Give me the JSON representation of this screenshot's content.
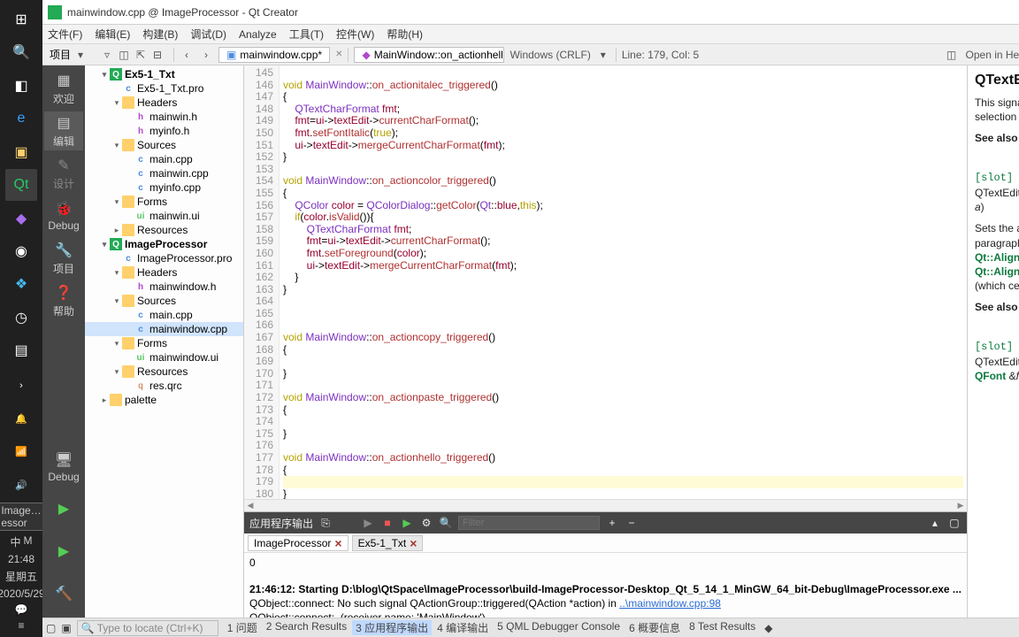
{
  "title": "mainwindow.cpp @ ImageProcessor - Qt Creator",
  "menubar": [
    "文件(F)",
    "编辑(E)",
    "构建(B)",
    "调试(D)",
    "Analyze",
    "工具(T)",
    "控件(W)",
    "帮助(H)"
  ],
  "pane_title": "项目",
  "toolbar": {
    "tab": "mainwindow.cpp*",
    "bread": "MainWindow::on_actionhello_t…",
    "encoding": "Windows (CRLF)",
    "pos": "Line: 179, Col: 5",
    "help_mode": "Open in Help Mode"
  },
  "rail": {
    "welcome": "欢迎",
    "edit": "编辑",
    "design": "设计",
    "debug": "Debug",
    "projects": "项目",
    "help": "帮助",
    "debug2": "Debug"
  },
  "tree": [
    {
      "lvl": 1,
      "caret": "▾",
      "ico": "proj",
      "label": "Ex5-1_Txt",
      "bold": true
    },
    {
      "lvl": 2,
      "caret": "",
      "ico": "cpp",
      "label": "Ex5-1_Txt.pro"
    },
    {
      "lvl": 2,
      "caret": "▾",
      "ico": "folder",
      "label": "Headers"
    },
    {
      "lvl": 3,
      "caret": "",
      "ico": "h",
      "label": "mainwin.h"
    },
    {
      "lvl": 3,
      "caret": "",
      "ico": "h",
      "label": "myinfo.h"
    },
    {
      "lvl": 2,
      "caret": "▾",
      "ico": "folder",
      "label": "Sources"
    },
    {
      "lvl": 3,
      "caret": "",
      "ico": "cpp",
      "label": "main.cpp"
    },
    {
      "lvl": 3,
      "caret": "",
      "ico": "cpp",
      "label": "mainwin.cpp"
    },
    {
      "lvl": 3,
      "caret": "",
      "ico": "cpp",
      "label": "myinfo.cpp"
    },
    {
      "lvl": 2,
      "caret": "▾",
      "ico": "folder",
      "label": "Forms"
    },
    {
      "lvl": 3,
      "caret": "",
      "ico": "ui",
      "label": "mainwin.ui"
    },
    {
      "lvl": 2,
      "caret": "▸",
      "ico": "folder",
      "label": "Resources"
    },
    {
      "lvl": 1,
      "caret": "▾",
      "ico": "proj",
      "label": "ImageProcessor",
      "bold": true
    },
    {
      "lvl": 2,
      "caret": "",
      "ico": "cpp",
      "label": "ImageProcessor.pro"
    },
    {
      "lvl": 2,
      "caret": "▾",
      "ico": "folder",
      "label": "Headers"
    },
    {
      "lvl": 3,
      "caret": "",
      "ico": "h",
      "label": "mainwindow.h"
    },
    {
      "lvl": 2,
      "caret": "▾",
      "ico": "folder",
      "label": "Sources"
    },
    {
      "lvl": 3,
      "caret": "",
      "ico": "cpp",
      "label": "main.cpp"
    },
    {
      "lvl": 3,
      "caret": "",
      "ico": "cpp",
      "label": "mainwindow.cpp",
      "sel": true
    },
    {
      "lvl": 2,
      "caret": "▾",
      "ico": "folder",
      "label": "Forms"
    },
    {
      "lvl": 3,
      "caret": "",
      "ico": "ui",
      "label": "mainwindow.ui"
    },
    {
      "lvl": 2,
      "caret": "▾",
      "ico": "folder",
      "label": "Resources"
    },
    {
      "lvl": 3,
      "caret": "",
      "ico": "qrc",
      "label": "res.qrc"
    },
    {
      "lvl": 1,
      "caret": "▸",
      "ico": "folder",
      "label": "palette"
    }
  ],
  "code_start": 145,
  "code_lines": [
    "",
    "<span class='kw'>void</span> <span class='cls'>MainWindow</span>::<span class='fn'>on_actionitalec_triggered</span>()",
    "{",
    "    <span class='cls'>QTextCharFormat</span> <span class='id'>fmt</span>;",
    "    <span class='id'>fmt</span>=<span class='id'>ui</span>-&gt;<span class='id'>textEdit</span>-&gt;<span class='fn'>currentCharFormat</span>();",
    "    <span class='id'>fmt</span>.<span class='fn'>setFontItalic</span>(<span class='kw'>true</span>);",
    "    <span class='id'>ui</span>-&gt;<span class='id'>textEdit</span>-&gt;<span class='fn'>mergeCurrentCharFormat</span>(<span class='id'>fmt</span>);",
    "}",
    "",
    "<span class='kw'>void</span> <span class='cls'>MainWindow</span>::<span class='fn'>on_actioncolor_triggered</span>()",
    "{",
    "    <span class='cls'>QColor</span> <span class='id'>color</span> = <span class='cls'>QColorDialog</span>::<span class='fn'>getColor</span>(<span class='cls'>Qt</span>::<span class='id'>blue</span>,<span class='kw'>this</span>);",
    "    <span class='kw'>if</span>(<span class='id'>color</span>.<span class='fn'>isValid</span>()){",
    "        <span class='cls'>QTextCharFormat</span> <span class='id'>fmt</span>;",
    "        <span class='id'>fmt</span>=<span class='id'>ui</span>-&gt;<span class='id'>textEdit</span>-&gt;<span class='fn'>currentCharFormat</span>();",
    "        <span class='id'>fmt</span>.<span class='fn'>setForeground</span>(<span class='id'>color</span>);",
    "        <span class='id'>ui</span>-&gt;<span class='id'>textEdit</span>-&gt;<span class='fn'>mergeCurrentCharFormat</span>(<span class='id'>fmt</span>);",
    "    }",
    "}",
    "",
    "",
    "",
    "<span class='kw'>void</span> <span class='cls'>MainWindow</span>::<span class='fn'>on_actioncopy_triggered</span>()",
    "{",
    "",
    "}",
    "",
    "<span class='kw'>void</span> <span class='cls'>MainWindow</span>::<span class='fn'>on_actionpaste_triggered</span>()",
    "{",
    "",
    "}",
    "",
    "<span class='kw'>void</span> <span class='cls'>MainWindow</span>::<span class='fn'>on_actionhello_triggered</span>()",
    "{",
    "<span class='cursor-line'>    </span>",
    "}",
    ""
  ],
  "output": {
    "title": "应用程序输出",
    "filter_placeholder": "Filter",
    "tabs": [
      "ImageProcessor",
      "Ex5-1_Txt"
    ],
    "body_head": "0",
    "body_start": "21:46:12: Starting D:\\blog\\QtSpace\\ImageProcessor\\build-ImageProcessor-Desktop_Qt_5_14_1_MinGW_64_bit-Debug\\ImageProcessor.exe ...",
    "body_l2a": "QObject::connect: No such signal QActionGroup::triggered(QAction *action) in ",
    "body_l2b": "..\\mainwindow.cpp:98",
    "body_l3": "QObject::connect:  (receiver name: 'MainWindow')"
  },
  "status": {
    "locate_placeholder": "Type to locate (Ctrl+K)",
    "items": [
      "1 问题",
      "2 Search Results",
      "3 应用程序输出",
      "4 编译输出",
      "5 QML Debugger Console",
      "6 概要信息",
      "8 Test Results"
    ],
    "active_idx": 2
  },
  "clock": {
    "time": "21:48",
    "date": "星期五",
    "full": "2020/5/29"
  },
  "taskbar_tip": "Image…essor"
}
